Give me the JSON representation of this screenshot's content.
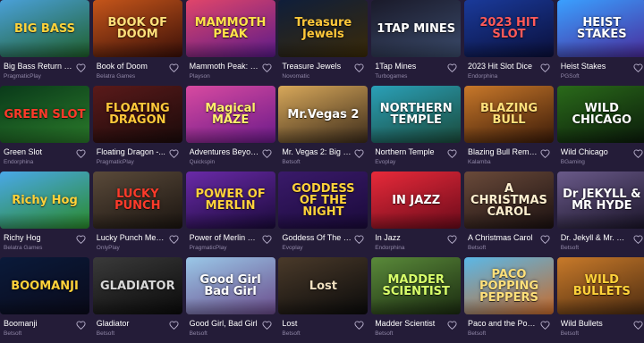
{
  "games": [
    {
      "title": "Big Bass Return to...",
      "provider": "PragmaticPlay",
      "art": "BIG BASS",
      "bg": [
        "#4aa0d8",
        "#1f5f2a"
      ],
      "fg": "#ffd23a",
      "icon": "heart-outline-icon"
    },
    {
      "title": "Book of Doom",
      "provider": "Belatra Games",
      "art": "BOOK OF DOOM",
      "bg": [
        "#c4551a",
        "#3a0f08"
      ],
      "fg": "#ffe07a",
      "icon": "heart-outline-icon"
    },
    {
      "title": "Mammoth Peak: H...",
      "provider": "Playson",
      "art": "MAMMOTH PEAK",
      "bg": [
        "#e0456a",
        "#5a1a8a"
      ],
      "fg": "#ffe34a",
      "icon": "heart-outline-icon"
    },
    {
      "title": "Treasure Jewels",
      "provider": "Novomatic",
      "art": "Treasure Jewels",
      "bg": [
        "#0f1e3a",
        "#3a2a08"
      ],
      "fg": "#ffc83a",
      "icon": "heart-outline-icon"
    },
    {
      "title": "1Tap Mines",
      "provider": "Turbogames",
      "art": "1TAP MINES",
      "bg": [
        "#1a1a2a",
        "#3a4a6a"
      ],
      "fg": "#ffffff",
      "icon": "heart-outline-icon"
    },
    {
      "title": "2023 Hit Slot Dice",
      "provider": "Endorphina",
      "art": "2023 HIT SLOT",
      "bg": [
        "#1a3a9a",
        "#0a0f3a"
      ],
      "fg": "#ff5a5a",
      "icon": "heart-outline-icon"
    },
    {
      "title": "Heist Stakes",
      "provider": "PGSoft",
      "art": "HEIST STAKES",
      "bg": [
        "#3aa0ff",
        "#4a2a9a"
      ],
      "fg": "#ffffff",
      "icon": "heart-outline-icon"
    },
    {
      "title": "Green Slot",
      "provider": "Endorphina",
      "art": "GREEN SLOT",
      "bg": [
        "#0a3a1a",
        "#2a7a2a"
      ],
      "fg": "#ff3a2a",
      "icon": "heart-outline-icon"
    },
    {
      "title": "Floating Dragon -...",
      "provider": "PragmaticPlay",
      "art": "FLOATING DRAGON",
      "bg": [
        "#5a1a1a",
        "#1a0a0a"
      ],
      "fg": "#ffc83a",
      "icon": "heart-outline-icon"
    },
    {
      "title": "Adventures Beyon...",
      "provider": "Quickspin",
      "art": "Magical MAZE",
      "bg": [
        "#d84aa0",
        "#6a1a8a"
      ],
      "fg": "#fff06a",
      "icon": "heart-outline-icon"
    },
    {
      "title": "Mr. Vegas 2: Big M...",
      "provider": "Betsoft",
      "art": "Mr.Vegas 2",
      "bg": [
        "#d8a85a",
        "#3a2a1a"
      ],
      "fg": "#ffffff",
      "icon": "heart-outline-icon"
    },
    {
      "title": "Northern Temple",
      "provider": "Evoplay",
      "art": "NORTHERN TEMPLE",
      "bg": [
        "#2aa0b8",
        "#1a4a3a"
      ],
      "fg": "#ffffff",
      "icon": "heart-outline-icon"
    },
    {
      "title": "Blazing Bull Rema...",
      "provider": "Kalamba",
      "art": "BLAZING BULL",
      "bg": [
        "#c8782a",
        "#3a1a08"
      ],
      "fg": "#ffe07a",
      "icon": "heart-outline-icon"
    },
    {
      "title": "Wild Chicago",
      "provider": "BGaming",
      "art": "WILD CHICAGO",
      "bg": [
        "#2a6a1a",
        "#0a1a0a"
      ],
      "fg": "#ffffff",
      "icon": "heart-outline-icon"
    },
    {
      "title": "Richy Hog",
      "provider": "Belatra Games",
      "art": "Richy Hog",
      "bg": [
        "#4aa8e8",
        "#2a8a2a"
      ],
      "fg": "#ffd23a",
      "icon": "heart-outline-icon"
    },
    {
      "title": "Lucky Punch Meg...",
      "provider": "OnlyPlay",
      "art": "LUCKY PUNCH",
      "bg": [
        "#5a4a3a",
        "#1a1410"
      ],
      "fg": "#ff3a2a",
      "icon": "heart-outline-icon"
    },
    {
      "title": "Power of Merlin M...",
      "provider": "PragmaticPlay",
      "art": "POWER OF MERLIN",
      "bg": [
        "#6a2aa8",
        "#1a0a3a"
      ],
      "fg": "#ffd23a",
      "icon": "heart-outline-icon"
    },
    {
      "title": "Goddess Of The Ni...",
      "provider": "Evoplay",
      "art": "GODDESS OF THE NIGHT",
      "bg": [
        "#3a1a6a",
        "#1a0a3a"
      ],
      "fg": "#ffd23a",
      "icon": "heart-outline-icon"
    },
    {
      "title": "In Jazz",
      "provider": "Endorphina",
      "art": "IN JAZZ",
      "bg": [
        "#e82a3a",
        "#6a0a1a"
      ],
      "fg": "#ffffff",
      "icon": "heart-outline-icon"
    },
    {
      "title": "A Christmas Carol",
      "provider": "Betsoft",
      "art": "A CHRISTMAS CAROL",
      "bg": [
        "#6a4a3a",
        "#1a1010"
      ],
      "fg": "#fff0d0",
      "icon": "heart-outline-icon"
    },
    {
      "title": "Dr. Jekyll & Mr. Hy...",
      "provider": "Betsoft",
      "art": "Dr JEKYLL & MR HYDE",
      "bg": [
        "#6a5a8a",
        "#1a1428"
      ],
      "fg": "#ffffff",
      "icon": "heart-outline-icon"
    },
    {
      "title": "Boomanji",
      "provider": "Betsoft",
      "art": "BOOMANJI",
      "bg": [
        "#0a1a3a",
        "#0a0a1a"
      ],
      "fg": "#ffd23a",
      "icon": "heart-outline-icon"
    },
    {
      "title": "Gladiator",
      "provider": "Betsoft",
      "art": "GLADIATOR",
      "bg": [
        "#3a3a3a",
        "#0a0a0a"
      ],
      "fg": "#d8d8d8",
      "icon": "heart-outline-icon"
    },
    {
      "title": "Good Girl, Bad Girl",
      "provider": "Betsoft",
      "art": "Good Girl Bad Girl",
      "bg": [
        "#9ac8e8",
        "#6a4a8a"
      ],
      "fg": "#ffffff",
      "icon": "heart-outline-icon"
    },
    {
      "title": "Lost",
      "provider": "Betsoft",
      "art": "Lost",
      "bg": [
        "#4a3a2a",
        "#0a0a0a"
      ],
      "fg": "#f0e0c0",
      "icon": "heart-outline-icon"
    },
    {
      "title": "Madder Scientist",
      "provider": "Betsoft",
      "art": "MADDER SCIENTIST",
      "bg": [
        "#5a8a3a",
        "#1a2a10"
      ],
      "fg": "#d8ff6a",
      "icon": "heart-outline-icon"
    },
    {
      "title": "Paco and the Pop...",
      "provider": "Betsoft",
      "art": "PACO POPPING PEPPERS",
      "bg": [
        "#5ab8e8",
        "#c86a2a"
      ],
      "fg": "#ffe07a",
      "icon": "heart-outline-icon"
    },
    {
      "title": "Wild Bullets",
      "provider": "Betsoft",
      "art": "WILD BULLETS",
      "bg": [
        "#c87a2a",
        "#4a2a10"
      ],
      "fg": "#ffd23a",
      "icon": "heart-outline-icon"
    }
  ]
}
